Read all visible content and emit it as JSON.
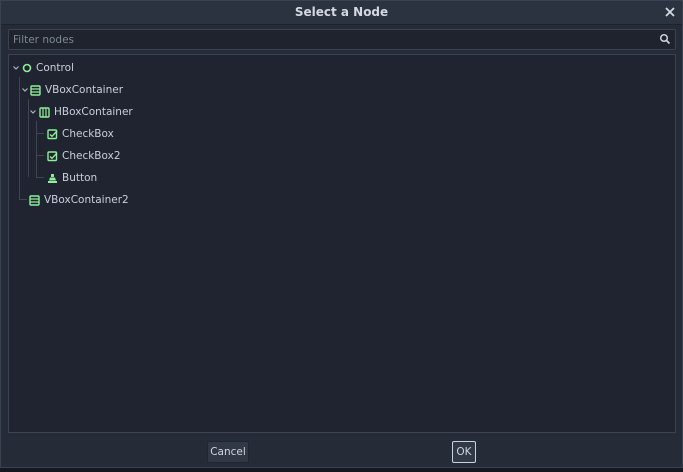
{
  "dialog": {
    "title": "Select a Node",
    "filter": {
      "placeholder": "Filter nodes",
      "value": ""
    },
    "tree": [
      {
        "label": "Control",
        "icon": "control-circle-icon",
        "expanded": true
      },
      {
        "label": "VBoxContainer",
        "icon": "vbox-container-icon",
        "expanded": true
      },
      {
        "label": "HBoxContainer",
        "icon": "hbox-container-icon",
        "expanded": true
      },
      {
        "label": "CheckBox",
        "icon": "checkbox-icon"
      },
      {
        "label": "CheckBox2",
        "icon": "checkbox-icon"
      },
      {
        "label": "Button",
        "icon": "button-icon"
      },
      {
        "label": "VBoxContainer2",
        "icon": "vbox-container-icon"
      }
    ],
    "buttons": {
      "cancel": "Cancel",
      "ok": "OK"
    }
  },
  "colors": {
    "node_green": "#8eef97",
    "dialog_bg": "#252b37",
    "tree_bg": "#1f2430"
  }
}
